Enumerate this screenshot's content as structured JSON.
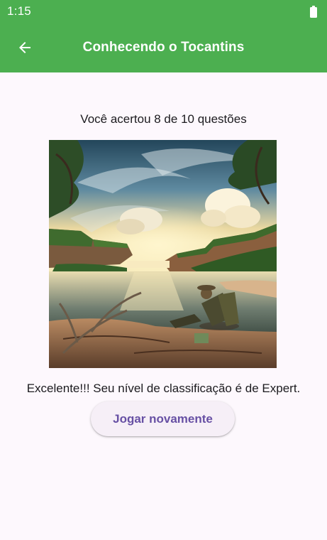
{
  "status_bar": {
    "time": "1:15",
    "battery_icon": "battery-full-icon"
  },
  "app_bar": {
    "title": "Conhecendo o Tocantins",
    "back_icon": "arrow-back-icon",
    "background_color": "#4caf50"
  },
  "quiz_result": {
    "score_text": "Você acertou 8 de 10 questões",
    "image_description_icon": "landscape-image",
    "classification_text": "Excelente!!! Seu nível de classificação é de Expert.",
    "play_again_label": "Jogar novamente",
    "button_text_color": "#6750a4"
  }
}
